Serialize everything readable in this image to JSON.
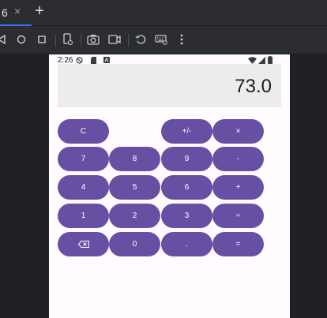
{
  "tab": {
    "label": "6",
    "close_glyph": "×",
    "add_glyph": "+"
  },
  "toolbar": {
    "icons": [
      "back-icon",
      "home-icon",
      "overview-icon",
      "device-frame-icon",
      "camera-icon",
      "video-icon",
      "rotate-icon",
      "keyboard-icon",
      "more-icon"
    ]
  },
  "status": {
    "time": "2:26"
  },
  "calculator": {
    "display": "73.0",
    "buttons": {
      "clear": "C",
      "plusminus": "+/-",
      "multiply": "×",
      "seven": "7",
      "eight": "8",
      "nine": "9",
      "minus": "-",
      "four": "4",
      "five": "5",
      "six": "6",
      "plus": "+",
      "one": "1",
      "two": "2",
      "three": "3",
      "divide": "÷",
      "zero": "0",
      "dot": ".",
      "equals": "="
    }
  },
  "colors": {
    "accent": "#6750a4",
    "display_bg": "#ececec",
    "screen_bg": "#fffbfe",
    "chrome_bg": "#2b2d30",
    "tab_indicator": "#3574f0"
  }
}
